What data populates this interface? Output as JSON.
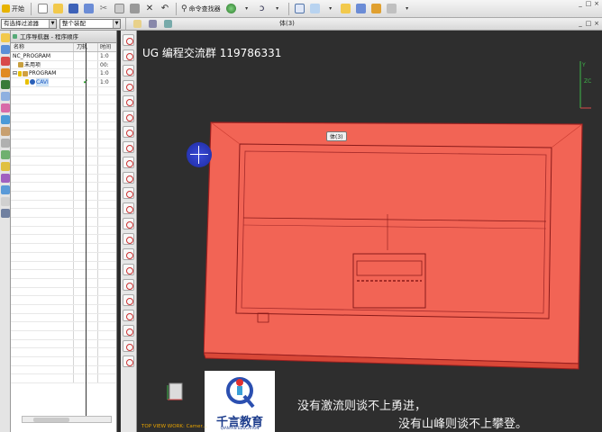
{
  "toolbar": {
    "start_label": "开始",
    "command_finder_label": "命令查找器"
  },
  "filters": {
    "selection_filter": "有选择过滤器",
    "assembly_scope": "整个装配"
  },
  "window": {
    "document_title": "体(3)",
    "controls": [
      "_",
      "□",
      "×"
    ]
  },
  "navigator": {
    "title": "工序导航器 - 程序顺序",
    "columns": {
      "name": "名称",
      "toolpath": "刀轨",
      "time": "时间"
    },
    "rows": [
      {
        "name": "NC_PROGRAM",
        "toolpath": "",
        "time": "1:0",
        "indent": 0,
        "icon": "program-root-icon"
      },
      {
        "name": "未用项",
        "toolpath": "",
        "time": "00:",
        "indent": 1,
        "icon": "unused-items-icon"
      },
      {
        "name": "PROGRAM",
        "toolpath": "",
        "time": "1:0",
        "indent": 1,
        "icon": "program-folder-icon"
      },
      {
        "name": "CAVI",
        "toolpath": "✔",
        "time": "1:0",
        "indent": 2,
        "icon": "cavity-mill-operation-icon",
        "selected": true
      }
    ]
  },
  "viewport": {
    "group_label": "UG 编程交流群 119786331",
    "body_tag": "体(3)",
    "view_status": "TOP VIEW WORK: Camer..."
  },
  "logo": {
    "name_cn": "千言教育",
    "name_en": "QIANYAN EDUCATION"
  },
  "slogan": {
    "line1": "没有激流则谈不上勇进，",
    "line2": "没有山峰则谈不上攀登。"
  },
  "colors": {
    "part_fill": "#f26455",
    "part_edge": "#9a1f1f",
    "viewport_bg": "#2e2e2e",
    "selection_blue": "#1b57c0",
    "check_green": "#1a9a1a",
    "view_status_text": "#e6a200"
  }
}
